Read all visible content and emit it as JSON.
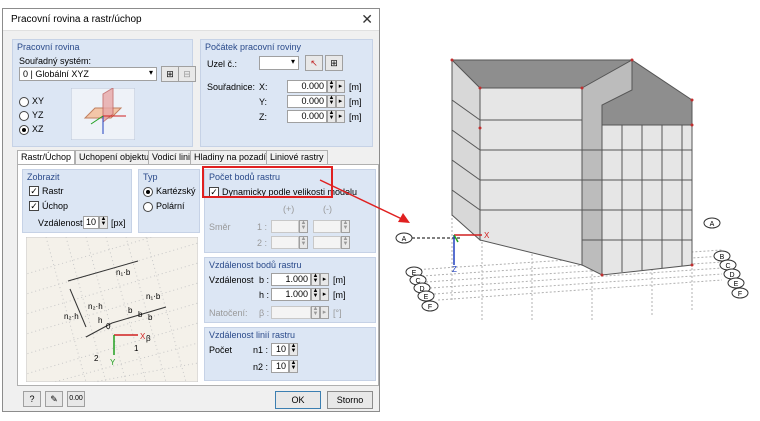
{
  "dialog": {
    "title": "Pracovní rovina a rastr/úchop",
    "close_icon": "close-icon",
    "work_plane": {
      "header": "Pracovní rovina",
      "coord_label": "Souřadný systém:",
      "coord_value": "0 | Globální XYZ",
      "planes": [
        "XY",
        "YZ",
        "XZ"
      ],
      "selected_plane": "XZ"
    },
    "origin": {
      "header": "Počátek pracovní roviny",
      "node_label": "Uzel č.:",
      "coords_label": "Souřadnice:",
      "x_label": "X:",
      "y_label": "Y:",
      "z_label": "Z:",
      "x": "0.000",
      "y": "0.000",
      "z": "0.000",
      "unit": "[m]"
    },
    "tabs": [
      "Rastr/Úchop",
      "Uchopení objektu",
      "Vodicí linie",
      "Hladiny na pozadí",
      "Liniové rastry"
    ],
    "active_tab": "Rastr/Úchop",
    "show": {
      "header": "Zobrazit",
      "grid": "Rastr",
      "snap": "Úchop",
      "distance_label": "Vzdálenost:",
      "distance": "10",
      "distance_unit": "[px]"
    },
    "type": {
      "header": "Typ",
      "cartesian": "Kartézský",
      "polar": "Polární",
      "selected": "Kartézský"
    },
    "points": {
      "header": "Počet bodů rastru",
      "dynamic_label": "Dynamicky podle velikosti modelu",
      "plus": "(+)",
      "minus": "(-)",
      "direction_label": "Směr",
      "row1": "1 :",
      "row2": "2 :"
    },
    "spacing": {
      "header": "Vzdálenost bodů rastru",
      "label": "Vzdálenost",
      "b_label": "b :",
      "h_label": "h :",
      "b": "1.000",
      "h": "1.000",
      "unit": "[m]",
      "rotation_label": "Natočení:",
      "beta_label": "β :",
      "rotation_unit": "[°]"
    },
    "linegrid": {
      "header": "Vzdálenost linií rastru",
      "count_label": "Počet",
      "n1_label": "n1 :",
      "n2_label": "n2 :",
      "n1": "10",
      "n2": "10"
    },
    "diagram": {
      "n1b": "n₁·b",
      "n2h": "n₂·h",
      "b": "b",
      "h": "h",
      "origin": "0",
      "beta": "β",
      "x": "X",
      "y": "Y",
      "one": "1",
      "two": "2"
    },
    "buttons": {
      "ok": "OK",
      "cancel": "Storno"
    }
  },
  "model": {
    "axis_x": "X",
    "axis_z": "Z",
    "left_labels": [
      "A",
      "E",
      "C",
      "D",
      "E",
      "F"
    ],
    "right_labels": [
      "A",
      "B",
      "C",
      "D",
      "E",
      "F"
    ]
  },
  "colors": {
    "highlight": "#e02020",
    "group_bg": "#dce6f4",
    "group_header": "#2a4a8a"
  }
}
